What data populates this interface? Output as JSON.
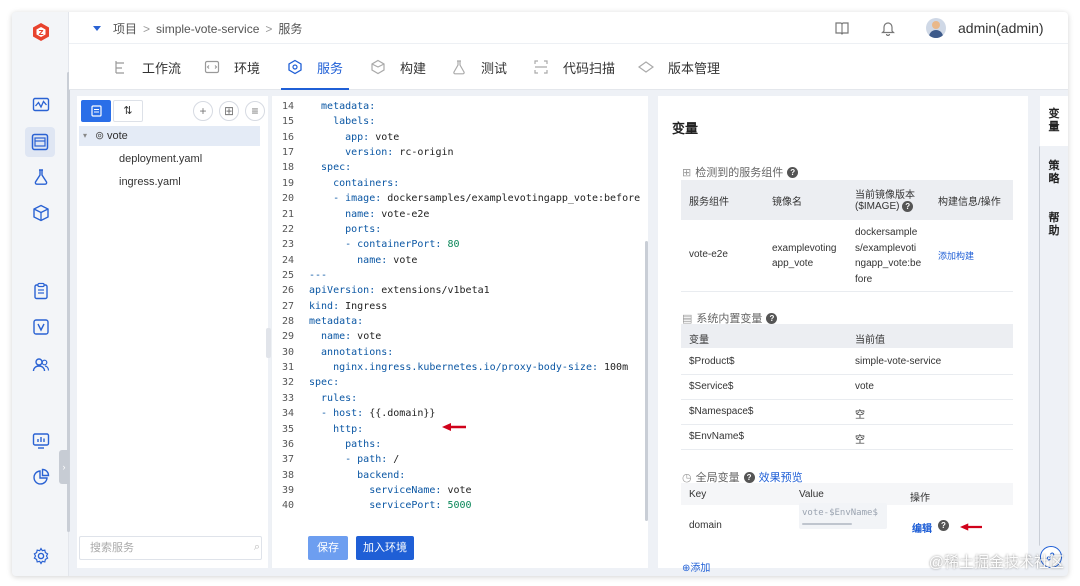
{
  "breadcrumb": {
    "items": [
      "项目",
      "simple-vote-service",
      "服务"
    ]
  },
  "user": {
    "name": "admin(admin)"
  },
  "tabs": [
    {
      "label": "工作流",
      "icon": "workflow-icon"
    },
    {
      "label": "环境",
      "icon": "environment-icon"
    },
    {
      "label": "服务",
      "icon": "service-icon",
      "active": true
    },
    {
      "label": "构建",
      "icon": "build-icon"
    },
    {
      "label": "测试",
      "icon": "test-icon"
    },
    {
      "label": "代码扫描",
      "icon": "code-scan-icon"
    },
    {
      "label": "版本管理",
      "icon": "version-icon"
    }
  ],
  "tree": {
    "sort_label": "⇅",
    "folder": "vote",
    "files": [
      "deployment.yaml",
      "ingress.yaml"
    ],
    "search_placeholder": "搜索服务"
  },
  "editor": {
    "lines": [
      {
        "n": "14",
        "indent": 2,
        "key": "metadata:",
        "val": ""
      },
      {
        "n": "15",
        "indent": 4,
        "key": "labels:",
        "val": ""
      },
      {
        "n": "16",
        "indent": 6,
        "key": "app:",
        "val": " vote"
      },
      {
        "n": "17",
        "indent": 6,
        "key": "version:",
        "val": " rc-origin"
      },
      {
        "n": "18",
        "indent": 2,
        "key": "spec:",
        "val": ""
      },
      {
        "n": "19",
        "indent": 4,
        "key": "containers:",
        "val": ""
      },
      {
        "n": "20",
        "indent": 4,
        "key": "- image:",
        "val": " dockersamples/examplevotingapp_vote:before"
      },
      {
        "n": "21",
        "indent": 6,
        "key": "name:",
        "val": " vote-e2e"
      },
      {
        "n": "22",
        "indent": 6,
        "key": "ports:",
        "val": ""
      },
      {
        "n": "23",
        "indent": 6,
        "key": "- containerPort:",
        "val": " 80",
        "num": true
      },
      {
        "n": "24",
        "indent": 8,
        "key": "name:",
        "val": " vote"
      },
      {
        "n": "25",
        "indent": 0,
        "key": "---",
        "val": ""
      },
      {
        "n": "26",
        "indent": 0,
        "key": "apiVersion:",
        "val": " extensions/v1beta1"
      },
      {
        "n": "27",
        "indent": 0,
        "key": "kind:",
        "val": " Ingress"
      },
      {
        "n": "28",
        "indent": 0,
        "key": "metadata:",
        "val": ""
      },
      {
        "n": "29",
        "indent": 2,
        "key": "name:",
        "val": " vote"
      },
      {
        "n": "30",
        "indent": 2,
        "key": "annotations:",
        "val": ""
      },
      {
        "n": "31",
        "indent": 4,
        "key": "nginx.ingress.kubernetes.io/proxy-body-size:",
        "val": " 100m"
      },
      {
        "n": "32",
        "indent": 0,
        "key": "spec:",
        "val": ""
      },
      {
        "n": "33",
        "indent": 2,
        "key": "rules:",
        "val": ""
      },
      {
        "n": "34",
        "indent": 2,
        "key": "- host:",
        "val": " {{.domain}}"
      },
      {
        "n": "35",
        "indent": 4,
        "key": "http:",
        "val": ""
      },
      {
        "n": "36",
        "indent": 6,
        "key": "paths:",
        "val": ""
      },
      {
        "n": "37",
        "indent": 6,
        "key": "- path:",
        "val": " /"
      },
      {
        "n": "38",
        "indent": 8,
        "key": "backend:",
        "val": ""
      },
      {
        "n": "39",
        "indent": 10,
        "key": "serviceName:",
        "val": " vote"
      },
      {
        "n": "40",
        "indent": 10,
        "key": "servicePort:",
        "val": " 5000",
        "num": true
      }
    ],
    "save_label": "保存",
    "add_env_label": "加入环境"
  },
  "vars": {
    "title": "变量",
    "detected": {
      "title": "检测到的服务组件",
      "headers": [
        "服务组件",
        "镜像名",
        "当前镜像版本",
        "($IMAGE)",
        "构建信息/操作"
      ],
      "row": {
        "component": "vote-e2e",
        "image_lines": [
          "examplevoting",
          "app_vote"
        ],
        "version_lines": [
          "dockersample",
          "s/examplevoti",
          "ngapp_vote:be",
          "fore"
        ],
        "action": "添加构建"
      }
    },
    "system": {
      "title": "系统内置变量",
      "headers": [
        "变量",
        "当前值"
      ],
      "rows": [
        {
          "k": "$Product$",
          "v": "simple-vote-service"
        },
        {
          "k": "$Service$",
          "v": "vote"
        },
        {
          "k": "$Namespace$",
          "v": "空"
        },
        {
          "k": "$EnvName$",
          "v": "空"
        }
      ]
    },
    "global": {
      "title": "全局变量",
      "preview": "效果预览",
      "headers": [
        "Key",
        "Value",
        "操作"
      ],
      "row": {
        "key": "domain",
        "value": "vote-$EnvName$",
        "action": "编辑"
      },
      "add_label": "⊕添加"
    }
  },
  "right_tabs": [
    "变量",
    "策略",
    "帮助"
  ],
  "watermark": "@稀土掘金技术社区",
  "colors": {
    "primary": "#1f5fd6",
    "arrow": "#d0021b"
  }
}
